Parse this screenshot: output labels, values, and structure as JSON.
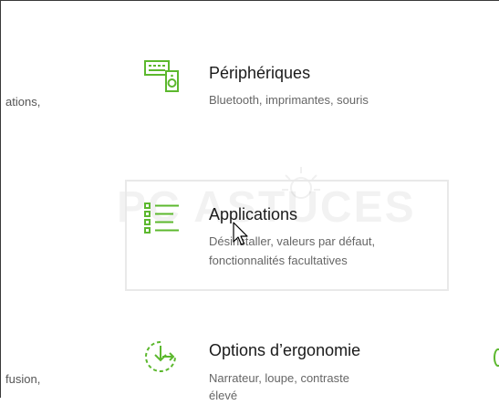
{
  "clipped_left": {
    "row1_text": "ations,",
    "row3_text": "fusion,"
  },
  "tiles": [
    {
      "title": "Périphériques",
      "desc_line1": "Bluetooth, imprimantes, souris",
      "desc_line2": "",
      "icon": "keyboard-speaker-icon"
    },
    {
      "title": "Applications",
      "desc_line1": "Désinstaller, valeurs par défaut,",
      "desc_line2": "fonctionnalités facultatives",
      "icon": "list-icon"
    },
    {
      "title": "Options d’ergonomie",
      "desc_line1": "Narrateur, loupe, contraste",
      "desc_line2": "élevé",
      "icon": "ease-of-access-icon"
    }
  ],
  "watermark": {
    "text": "PC ASTUCES"
  },
  "accent_color": "#5cb82e"
}
